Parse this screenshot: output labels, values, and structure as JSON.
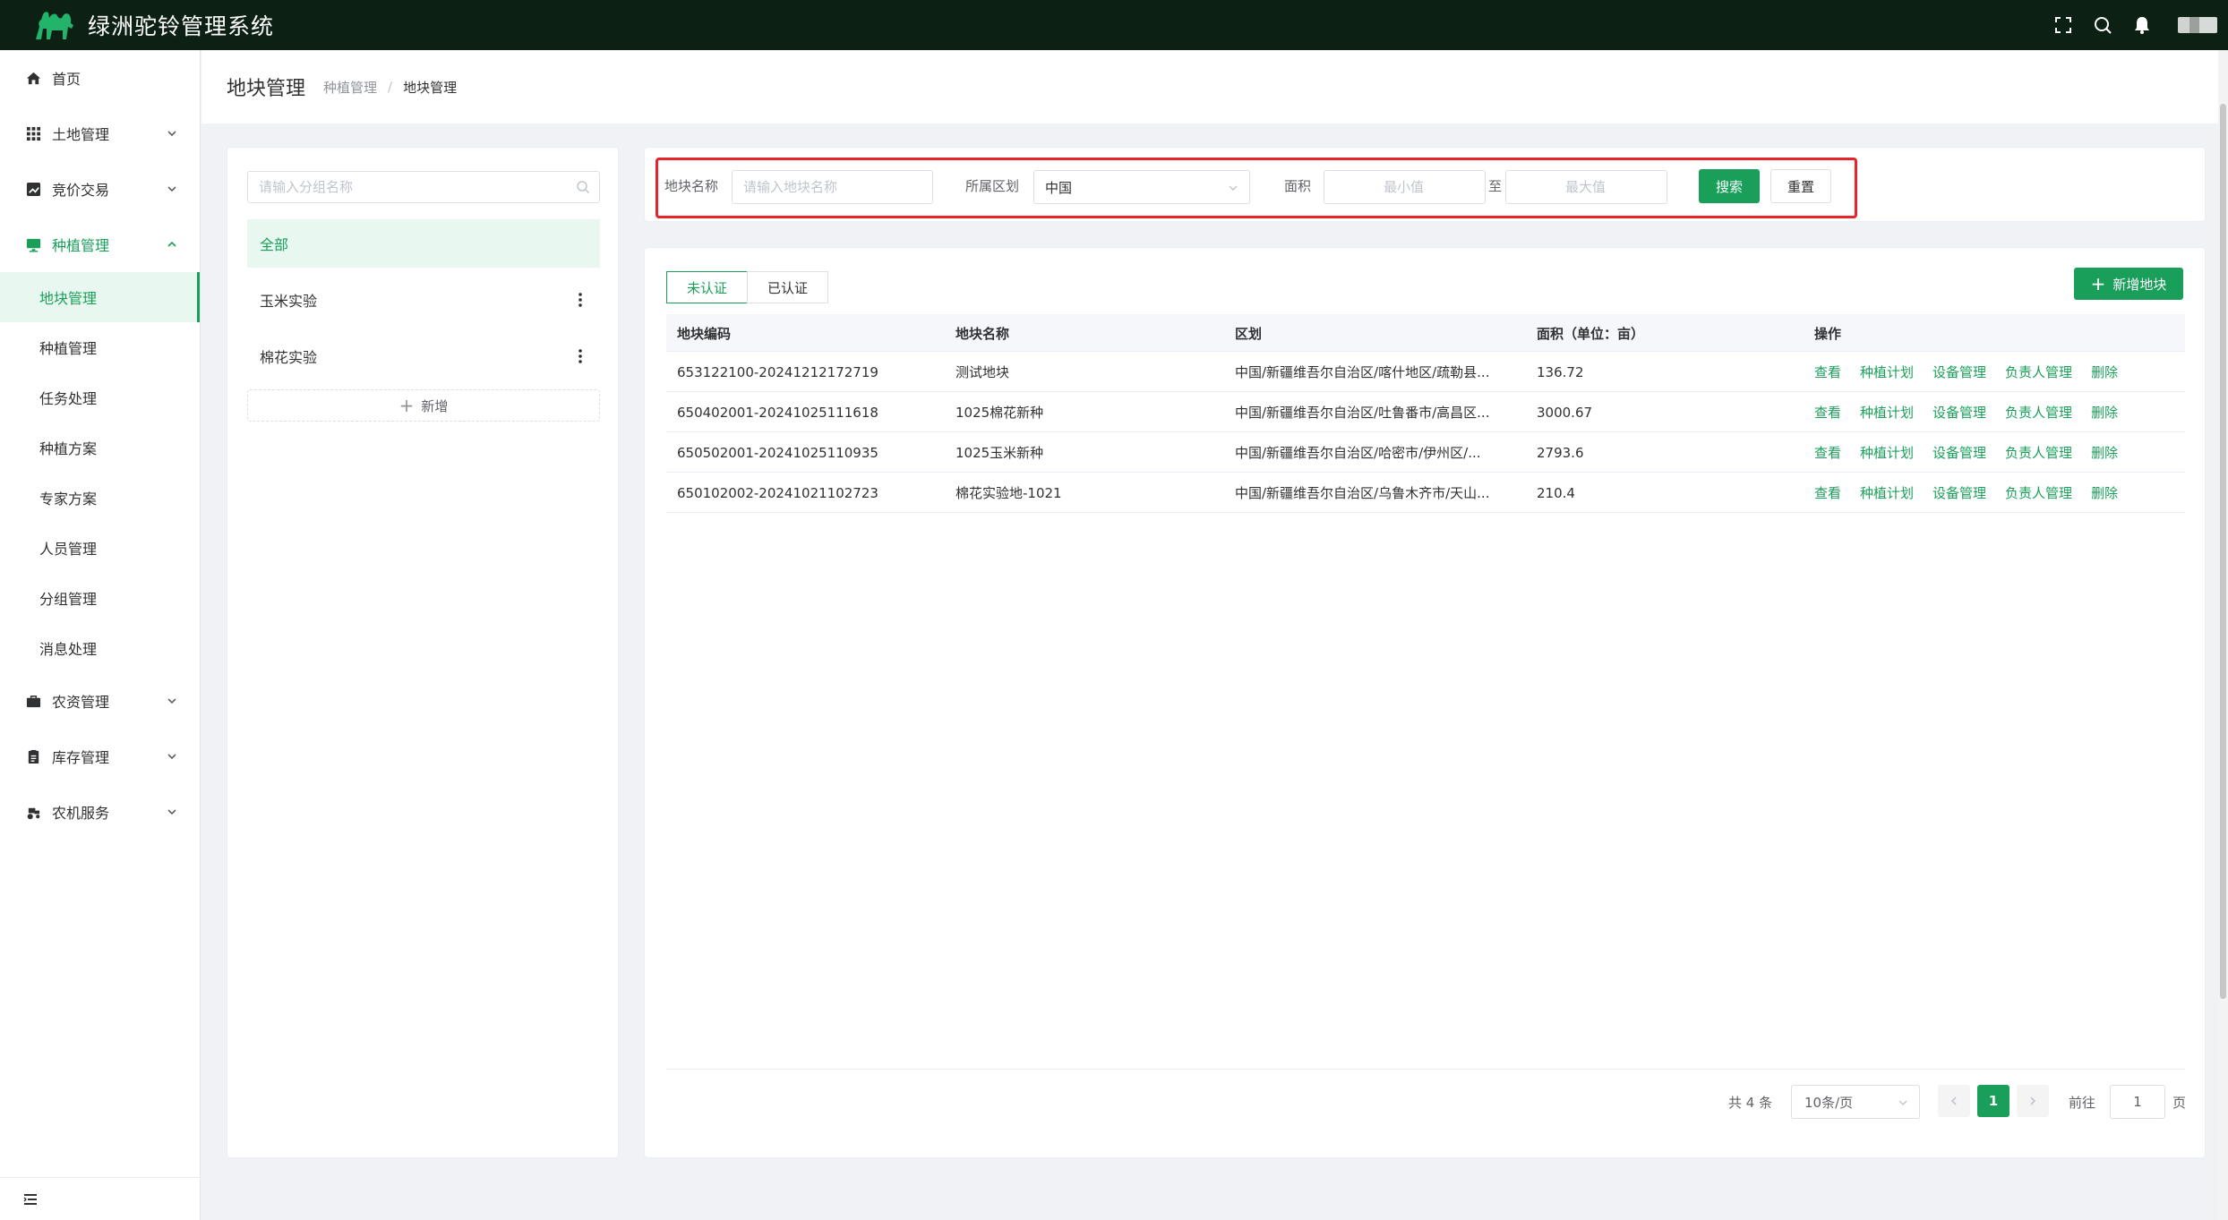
{
  "header": {
    "app_title": "绿洲驼铃管理系统",
    "icons": [
      "fullscreen-icon",
      "search-icon",
      "bell-icon"
    ]
  },
  "sidebar": {
    "items": [
      {
        "label": "首页",
        "icon": "home-icon"
      },
      {
        "label": "土地管理",
        "icon": "grid-icon"
      },
      {
        "label": "竞价交易",
        "icon": "chart-icon"
      },
      {
        "label": "种植管理",
        "icon": "monitor-icon"
      },
      {
        "label": "农资管理",
        "icon": "briefcase-icon"
      },
      {
        "label": "库存管理",
        "icon": "clipboard-icon"
      },
      {
        "label": "农机服务",
        "icon": "tractor-icon"
      }
    ],
    "sub_items": [
      "地块管理",
      "种植管理",
      "任务处理",
      "种植方案",
      "专家方案",
      "人员管理",
      "分组管理",
      "消息处理"
    ],
    "active_sub": "地块管理"
  },
  "breadcrumb": {
    "title": "地块管理",
    "parent": "种植管理",
    "separator": "/",
    "current": "地块管理"
  },
  "groups": {
    "search_placeholder": "请输入分组名称",
    "items": [
      "全部",
      "玉米实验",
      "棉花实验"
    ],
    "add_label": "新增"
  },
  "filter": {
    "name_label": "地块名称",
    "name_placeholder": "请输入地块名称",
    "region_label": "所属区划",
    "region_value": "中国",
    "area_label": "面积",
    "min_placeholder": "最小值",
    "to_label": "至",
    "max_placeholder": "最大值",
    "search_button": "搜索",
    "reset_button": "重置"
  },
  "table": {
    "tabs": [
      "未认证",
      "已认证"
    ],
    "active_tab": "未认证",
    "add_button": "新增地块",
    "columns": [
      "地块编码",
      "地块名称",
      "区划",
      "面积（单位：亩）",
      "操作"
    ],
    "operations": [
      "查看",
      "种植计划",
      "设备管理",
      "负责人管理",
      "删除"
    ],
    "rows": [
      {
        "code": "653122100-20241212172719",
        "name": "测试地块",
        "region": "中国/新疆维吾尔自治区/喀什地区/疏勒县...",
        "area": "136.72"
      },
      {
        "code": "650402001-20241025111618",
        "name": "1025棉花新种",
        "region": "中国/新疆维吾尔自治区/吐鲁番市/高昌区...",
        "area": "3000.67"
      },
      {
        "code": "650502001-20241025110935",
        "name": "1025玉米新种",
        "region": "中国/新疆维吾尔自治区/哈密市/伊州区/...",
        "area": "2793.6"
      },
      {
        "code": "650102002-20241021102723",
        "name": "棉花实验地-1021",
        "region": "中国/新疆维吾尔自治区/乌鲁木齐市/天山...",
        "area": "210.4"
      }
    ]
  },
  "pagination": {
    "total_text": "共 4 条",
    "page_size": "10条/页",
    "current_page": "1",
    "goto_label": "前往",
    "goto_value": "1",
    "page_suffix": "页"
  },
  "colors": {
    "primary": "#1a9f5b",
    "header_bg": "#0c2014",
    "highlight": "#e8232a"
  }
}
